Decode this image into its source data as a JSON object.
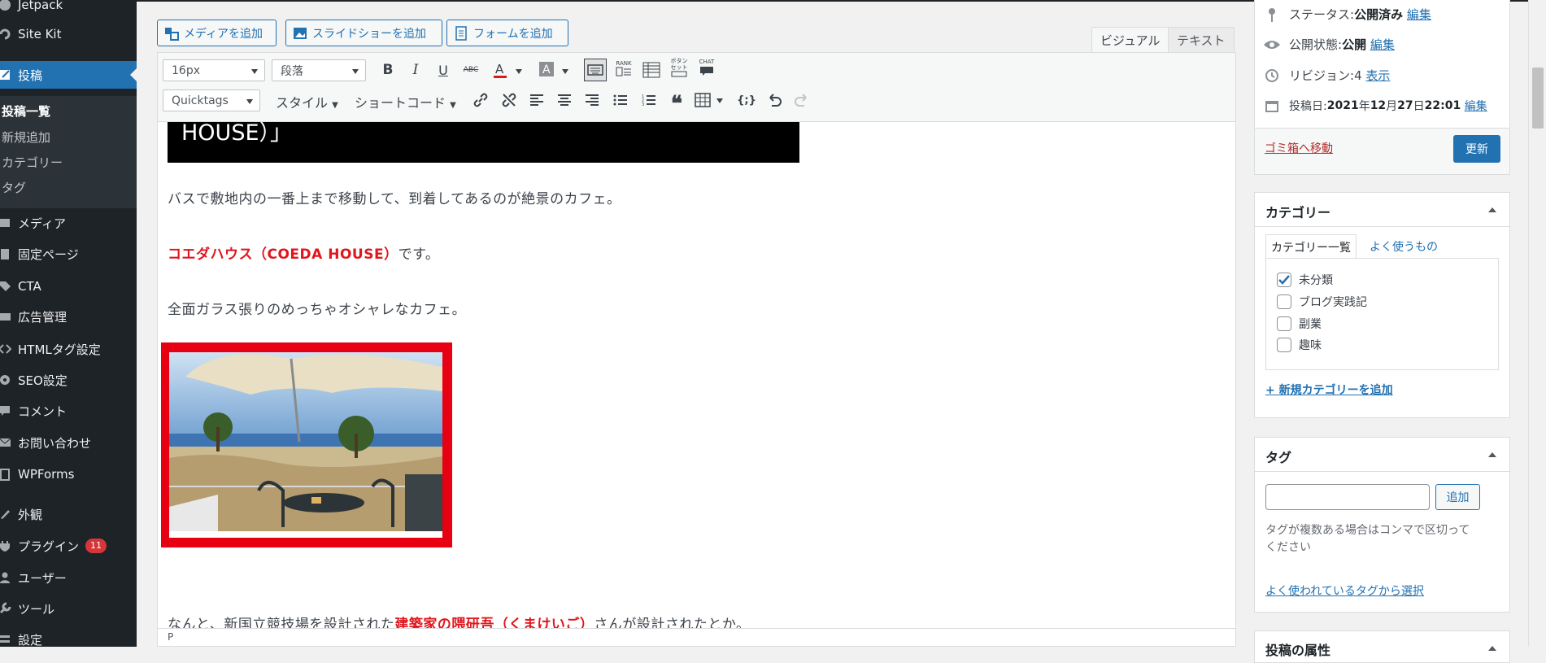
{
  "sidebar": {
    "items": [
      {
        "label": "Jetpack",
        "icon": "jetpack-icon"
      },
      {
        "label": "Site Kit",
        "icon": "sitekit-icon"
      },
      {
        "label": "投稿",
        "icon": "pin-icon"
      },
      {
        "label": "メディア",
        "icon": "media-icon"
      },
      {
        "label": "固定ページ",
        "icon": "page-icon"
      },
      {
        "label": "CTA",
        "icon": "tag-icon"
      },
      {
        "label": "広告管理",
        "icon": "ad-icon"
      },
      {
        "label": "HTMLタグ設定",
        "icon": "code-icon"
      },
      {
        "label": "SEO設定",
        "icon": "gear-icon"
      },
      {
        "label": "コメント",
        "icon": "comment-icon"
      },
      {
        "label": "お問い合わせ",
        "icon": "mail-icon"
      },
      {
        "label": "WPForms",
        "icon": "forms-icon"
      },
      {
        "label": "外観",
        "icon": "brush-icon"
      },
      {
        "label": "プラグイン",
        "icon": "plugin-icon",
        "badge": "11"
      },
      {
        "label": "ユーザー",
        "icon": "user-icon"
      },
      {
        "label": "ツール",
        "icon": "wrench-icon"
      },
      {
        "label": "設定",
        "icon": "settings-icon"
      }
    ],
    "submenu": [
      "投稿一覧",
      "新規追加",
      "カテゴリー",
      "タグ"
    ]
  },
  "editor": {
    "buttons": {
      "add_media": "メディアを追加",
      "add_slideshow": "スライドショーを追加",
      "add_form": "フォームを追加"
    },
    "tabs": {
      "visual": "ビジュアル",
      "text": "テキスト"
    },
    "toolbar": {
      "font_size": "16px",
      "format": "段落",
      "quicktags": "Quicktags",
      "style": "スタイル",
      "shortcode": "ショートコード",
      "rank_label": "RANK",
      "button_set_label_1": "ボタン",
      "button_set_label_2": "セット",
      "chat_label": "CHAT",
      "text_color": "#e0161c",
      "bg_color": "#8c8f94"
    },
    "content": {
      "heading_tail": "HOUSE）」",
      "para1": "バスで敷地内の一番上まで移動して、到着してあるのが絶景のカフェ。",
      "para2_red": "コエダハウス（COEDA HOUSE）",
      "para2_rest": "です。",
      "para3": "全面ガラス張りのめっちゃオシャレなカフェ。",
      "para4_pre": "なんと、新国立競技場を設計された",
      "para4_red": "建築家の隈研吾（くまけいご）",
      "para4_post": "さんが設計されたとか。",
      "accent_red": "#e0161c",
      "frame_color": "#e60012"
    },
    "path": "P"
  },
  "publish": {
    "status_label": "ステータス: ",
    "status_value": "公開済み",
    "visibility_label": "公開状態: ",
    "visibility_value": "公開",
    "revisions_label": "リビジョン: ",
    "revisions_value": "4",
    "revisions_link": "表示",
    "date_label": "投稿日: ",
    "date_value_bold1": "2021",
    "date_value_mid1": "年",
    "date_value_bold2": "12",
    "date_value_mid2": "月",
    "date_value_bold3": "27",
    "date_value_mid3": "日 ",
    "date_value_bold4": "22:01",
    "edit": "編集",
    "trash": "ゴミ箱へ移動",
    "update": "更新"
  },
  "categories": {
    "title": "カテゴリー",
    "tab_all": "カテゴリー一覧",
    "tab_popular": "よく使うもの",
    "items": [
      {
        "label": "未分類",
        "checked": true
      },
      {
        "label": "ブログ実践記",
        "checked": false
      },
      {
        "label": "副業",
        "checked": false
      },
      {
        "label": "趣味",
        "checked": false
      }
    ],
    "add_new": "+ 新規カテゴリーを追加"
  },
  "tags": {
    "title": "タグ",
    "add": "追加",
    "help": "タグが複数ある場合はコンマで区切ってください",
    "help_line1": "タグが複数ある場合はコンマで区切って",
    "help_line2": "ください",
    "choose": "よく使われているタグから選択"
  },
  "attributes": {
    "title": "投稿の属性"
  }
}
